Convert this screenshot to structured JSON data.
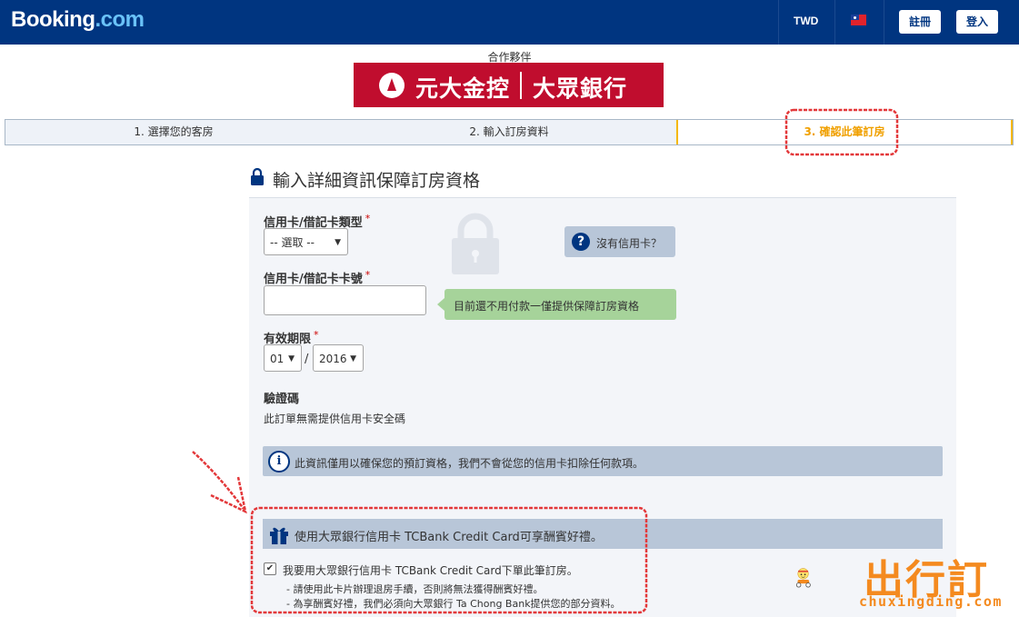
{
  "header": {
    "logo_main": "Booking",
    "logo_suffix": ".com",
    "currency": "TWD",
    "flag_icon": "taiwan-flag-icon",
    "register_label": "註冊",
    "login_label": "登入",
    "brand_color": "#003580"
  },
  "partner": {
    "label": "合作夥伴",
    "banner_left": "元大金控",
    "banner_right": "大眾銀行",
    "banner_color": "#c00d2e"
  },
  "steps": [
    {
      "label": "1. 選擇您的客房"
    },
    {
      "label": "2. 輸入訂房資料"
    },
    {
      "label": "3. 確認此筆訂房",
      "active": true
    }
  ],
  "form": {
    "title": "輸入詳細資訊保障訂房資格",
    "card_type_label": "信用卡/借記卡類型",
    "card_type_value": "-- 選取 --",
    "no_card_label": "沒有信用卡？",
    "card_number_label": "信用卡/借記卡卡號",
    "card_number_value": "",
    "tip_text": "目前還不用付款一僅提供保障訂房資格",
    "expiry_label": "有效期限",
    "expiry_month": "01",
    "expiry_year": "2016",
    "expiry_separator": "/",
    "required_mark": "*",
    "cvv_label": "驗證碼",
    "cvv_text": "此訂單無需提供信用卡安全碼",
    "info_text": "此資訊僅用以確保您的預訂資格，我們不會從您的信用卡扣除任何款項。",
    "promo_text": "使用大眾銀行信用卡 TCBank Credit Card可享酬賓好禮。",
    "promo_checkbox_label": "我要用大眾銀行信用卡 TCBank Credit Card下單此筆訂房。",
    "promo_checkbox_checked": true,
    "note_1": "- 請使用此卡片辦理退房手續，否則將無法獲得酬賓好禮。",
    "note_2": "- 為享酬賓好禮，我們必須向大眾銀行 Ta Chong Bank提供您的部分資料。"
  },
  "watermark": {
    "text": "出行訂",
    "url": "chuxingding.com",
    "color": "#f48a1f"
  }
}
